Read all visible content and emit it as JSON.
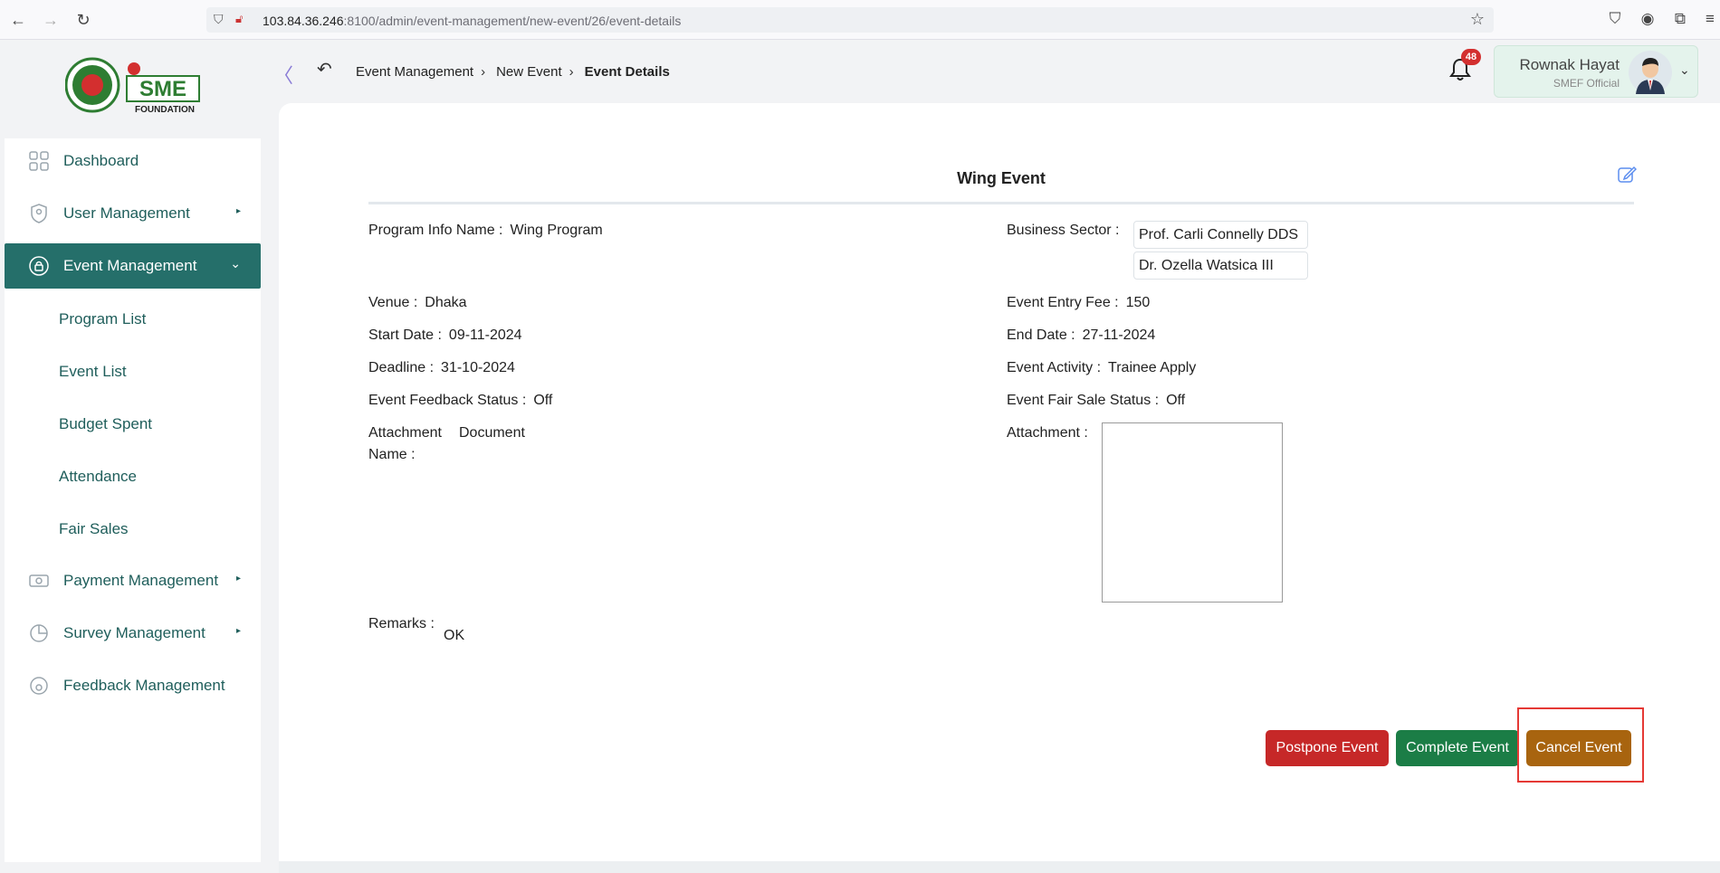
{
  "browser": {
    "url_host": "103.84.36.246",
    "url_rest": ":8100/admin/event-management/new-event/26/event-details"
  },
  "header": {
    "logo_text": "SME",
    "logo_subtext": "FOUNDATION",
    "breadcrumb": [
      "Event Management",
      "New Event",
      "Event Details"
    ],
    "notification_count": "48",
    "user": {
      "name": "Rownak Hayat",
      "role": "SMEF Official"
    }
  },
  "sidebar": {
    "items": [
      {
        "label": "Dashboard"
      },
      {
        "label": "User Management"
      },
      {
        "label": "Event Management"
      },
      {
        "label": "Payment Management"
      },
      {
        "label": "Survey Management"
      },
      {
        "label": "Feedback Management"
      }
    ],
    "sub_items": [
      "Program List",
      "Event List",
      "Budget Spent",
      "Attendance",
      "Fair Sales"
    ]
  },
  "event": {
    "title": "Wing Event",
    "program_info_name_label": "Program Info Name :",
    "program_info_name": "Wing Program",
    "business_sector_label": "Business Sector :",
    "business_sectors": [
      "Prof. Carli Connelly DDS",
      "Dr. Ozella Watsica III"
    ],
    "venue_label": "Venue :",
    "venue": "Dhaka",
    "entry_fee_label": "Event Entry Fee :",
    "entry_fee": "150",
    "start_date_label": "Start Date :",
    "start_date": "09-11-2024",
    "end_date_label": "End Date :",
    "end_date": "27-11-2024",
    "deadline_label": "Deadline :",
    "deadline": "31-10-2024",
    "activity_label": "Event Activity :",
    "activity": "Trainee Apply",
    "feedback_status_label": "Event Feedback Status :",
    "feedback_status": "Off",
    "fair_sale_status_label": "Event Fair Sale Status :",
    "fair_sale_status": "Off",
    "attachment_doc_label_1": "Attachment",
    "attachment_doc_label_2": "Document",
    "attachment_doc_label_3": "Name :",
    "attachment_label": "Attachment :",
    "remarks_label": "Remarks :",
    "remarks": "OK"
  },
  "actions": {
    "postpone": "Postpone Event",
    "complete": "Complete Event",
    "cancel": "Cancel Event"
  },
  "colors": {
    "primary": "#256f6a",
    "postpone": "#c62828",
    "complete": "#1b7d46",
    "cancel": "#a8640f",
    "highlight": "#e53935"
  }
}
